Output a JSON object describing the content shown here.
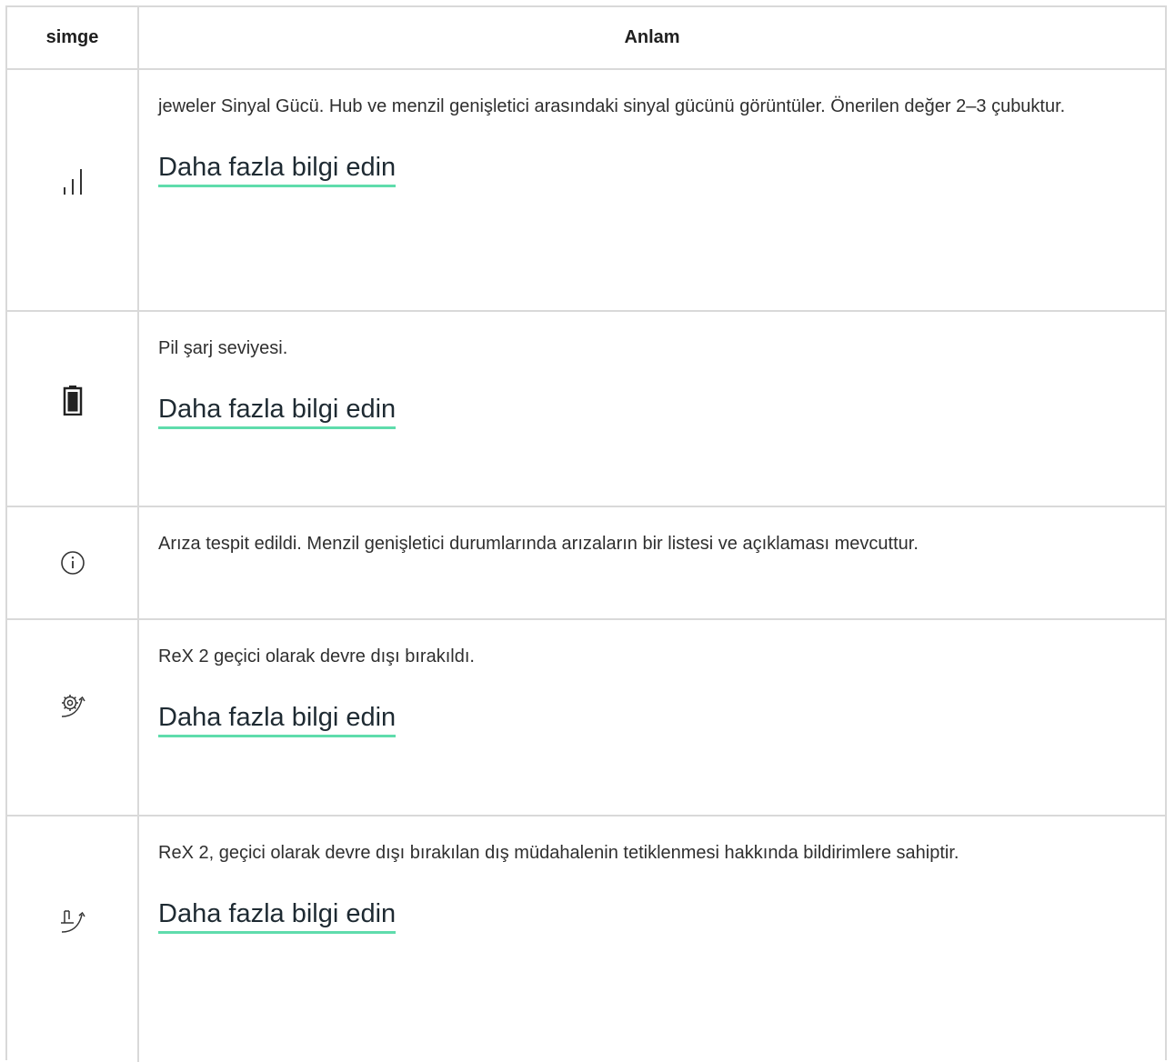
{
  "header": {
    "col_icon": "simge",
    "col_meaning": "Anlam"
  },
  "rows": [
    {
      "icon": "signal-strength-icon",
      "text": "jeweler Sinyal Gücü. Hub ve menzil genişletici arasındaki sinyal gücünü görüntüler. Önerilen değer 2–3 çubuktur.",
      "link": "Daha fazla bilgi edin"
    },
    {
      "icon": "battery-icon",
      "text": "Pil şarj seviyesi.",
      "link": "Daha fazla bilgi edin"
    },
    {
      "icon": "info-icon",
      "text": "Arıza tespit edildi. Menzil genişletici durumlarında arızaların bir listesi ve açıklaması mevcuttur."
    },
    {
      "icon": "gear-disabled-icon",
      "text": "ReX 2 geçici olarak devre dışı bırakıldı.",
      "link": "Daha fazla bilgi edin"
    },
    {
      "icon": "tamper-disabled-icon",
      "text": "ReX 2, geçici olarak devre dışı bırakılan dış müdahalenin tetiklenmesi hakkında bildirimlere sahiptir.",
      "link": "Daha fazla bilgi edin"
    }
  ]
}
